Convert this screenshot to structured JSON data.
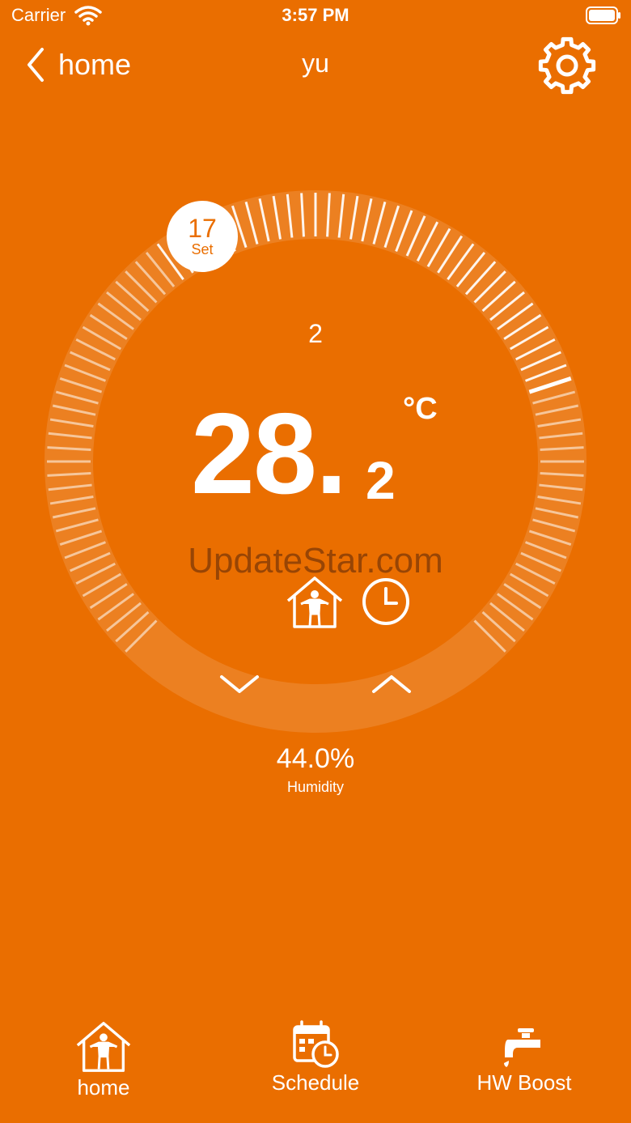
{
  "status_bar": {
    "carrier": "Carrier",
    "time": "3:57 PM"
  },
  "nav": {
    "back_label": "home",
    "title": "yu"
  },
  "dial": {
    "set_value": "17",
    "set_label": "Set",
    "mode_number": "2",
    "temp_integer": "28.",
    "temp_decimal": "2",
    "unit": "°C"
  },
  "watermark": "UpdateStar.com",
  "humidity": {
    "value": "44.0%",
    "label": "Humidity"
  },
  "tabs": [
    {
      "label": "home",
      "icon": "house-person-icon"
    },
    {
      "label": "Schedule",
      "icon": "calendar-clock-icon"
    },
    {
      "label": "HW Boost",
      "icon": "faucet-icon"
    }
  ],
  "colors": {
    "background": "#EA6E00",
    "foreground": "#FFFFFF"
  }
}
